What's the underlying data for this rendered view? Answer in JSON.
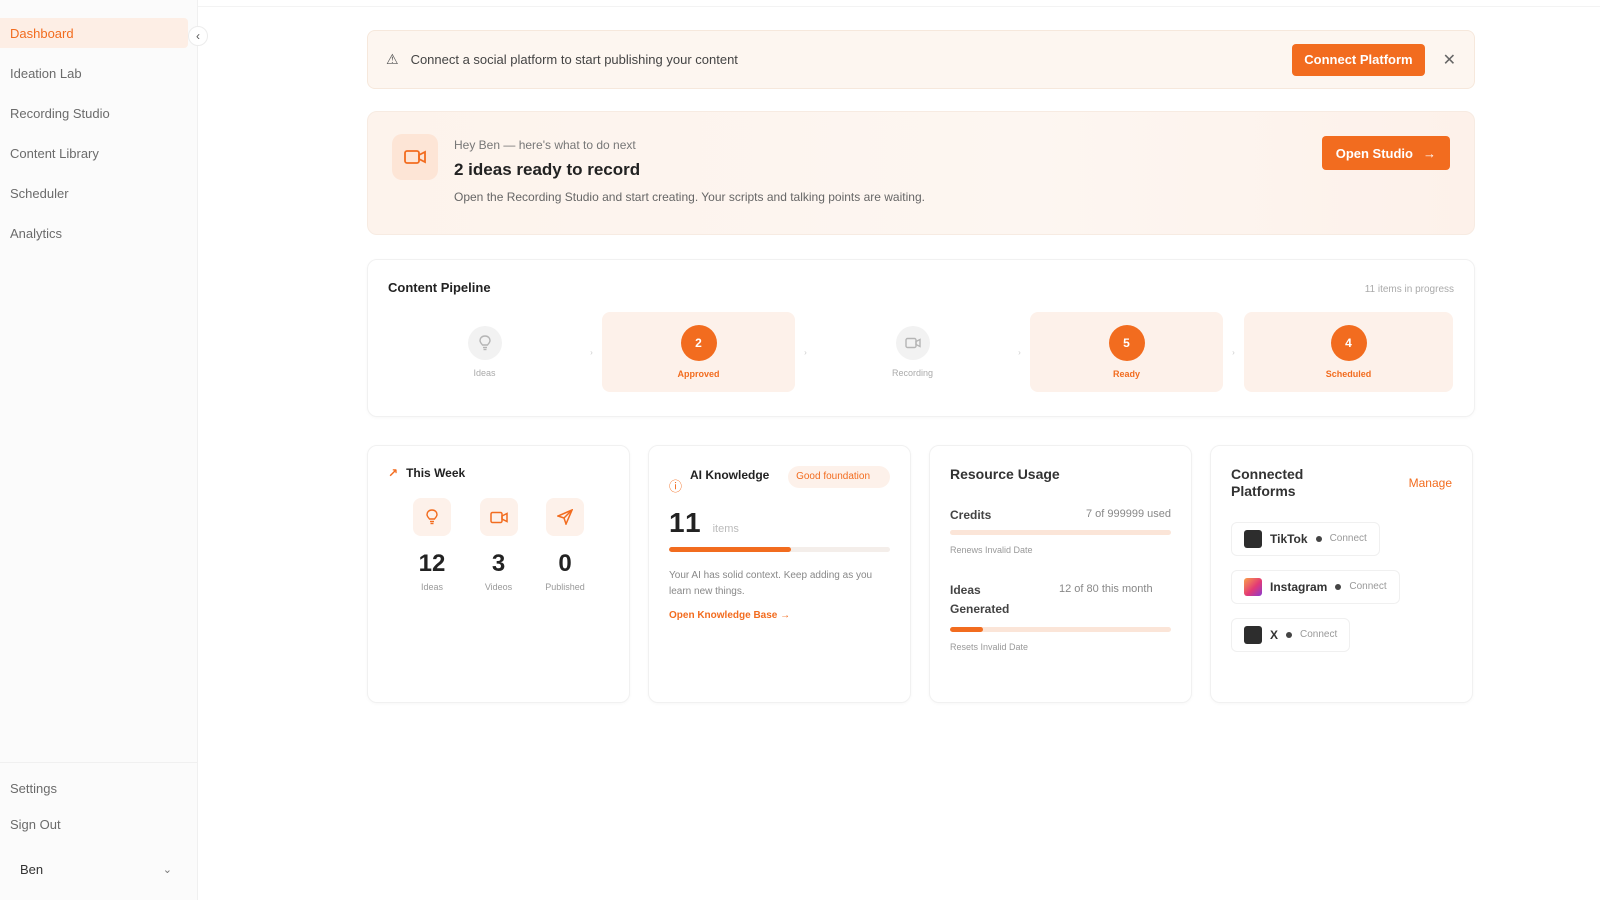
{
  "sidebar": {
    "nav": [
      {
        "label": "Dashboard",
        "active": true
      },
      {
        "label": "Ideation Lab"
      },
      {
        "label": "Recording Studio"
      },
      {
        "label": "Content Library"
      },
      {
        "label": "Scheduler"
      },
      {
        "label": "Analytics"
      }
    ],
    "settings": "Settings",
    "sign_out": "Sign Out",
    "user": "Ben"
  },
  "alert": {
    "text": "Connect a social platform to start publishing your content",
    "button": "Connect Platform"
  },
  "hero": {
    "greeting": "Hey Ben — here's what to do next",
    "headline": "2 ideas ready to record",
    "subtext": "Open the Recording Studio and start creating. Your scripts and talking points are waiting.",
    "button": "Open Studio"
  },
  "pipeline": {
    "title": "Content Pipeline",
    "meta": "11 items in progress",
    "stages": [
      {
        "label": "Ideas",
        "count": null,
        "icon": "lightbulb-icon"
      },
      {
        "label": "Approved",
        "count": "2"
      },
      {
        "label": "Recording",
        "count": null,
        "icon": "video-camera-icon"
      },
      {
        "label": "Ready",
        "count": "5"
      },
      {
        "label": "Scheduled",
        "count": "4"
      }
    ]
  },
  "this_week": {
    "title": "This Week",
    "stats": [
      {
        "value": "12",
        "label": "Ideas",
        "icon": "lightbulb-icon"
      },
      {
        "value": "3",
        "label": "Videos",
        "icon": "video-camera-icon"
      },
      {
        "value": "0",
        "label": "Published",
        "icon": "send-icon"
      }
    ]
  },
  "ai_knowledge": {
    "title": "AI Knowledge",
    "badge": "Good foundation",
    "count": "11",
    "unit": "items",
    "progress_fraction": 0.55,
    "description": "Your AI has solid context. Keep adding as you learn new things.",
    "link": "Open Knowledge Base →"
  },
  "resource_usage": {
    "title": "Resource Usage",
    "credits_label": "Credits",
    "credits_value": "7 of 999999 used",
    "credits_fraction": 0.0,
    "credits_note": "Renews Invalid Date",
    "ideas_label": "Ideas Generated",
    "ideas_value": "12 of 80 this month",
    "ideas_fraction": 0.15,
    "ideas_note": "Resets Invalid Date"
  },
  "connected_platforms": {
    "title": "Connected Platforms",
    "manage": "Manage",
    "platforms": [
      {
        "name": "TikTok",
        "action": "Connect"
      },
      {
        "name": "Instagram",
        "action": "Connect"
      },
      {
        "name": "X",
        "action": "Connect"
      }
    ]
  },
  "colors": {
    "accent": "#f26c1f",
    "accent_soft": "#fdf1ea"
  }
}
